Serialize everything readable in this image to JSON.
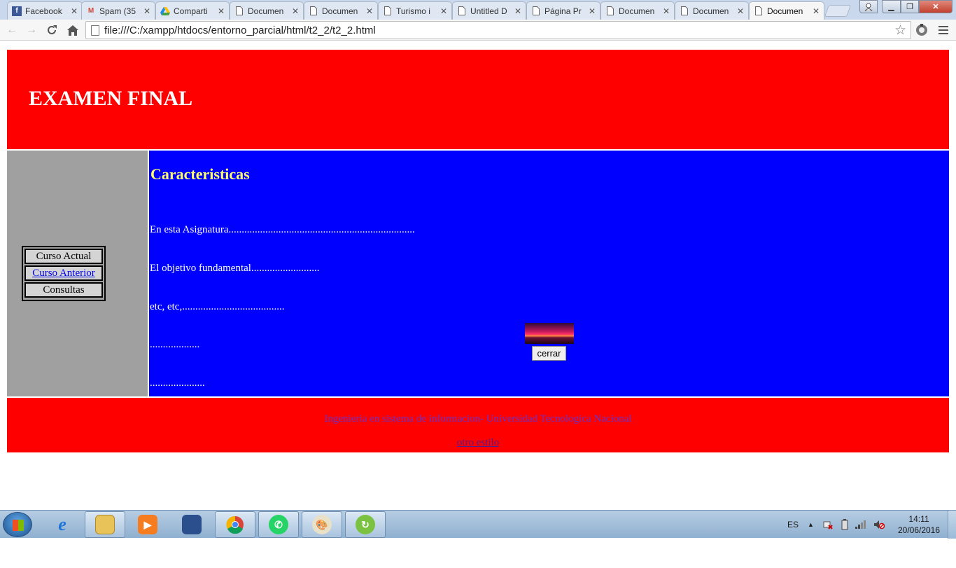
{
  "browser": {
    "tabs": [
      {
        "label": "Facebook",
        "icon": "facebook-icon",
        "active": false
      },
      {
        "label": "Spam (35",
        "icon": "gmail-icon",
        "active": false
      },
      {
        "label": "Comparti",
        "icon": "drive-icon",
        "active": false
      },
      {
        "label": "Documen",
        "icon": "document-icon",
        "active": false
      },
      {
        "label": "Documen",
        "icon": "document-icon",
        "active": false
      },
      {
        "label": "Turismo i",
        "icon": "document-icon",
        "active": false
      },
      {
        "label": "Untitled D",
        "icon": "document-icon",
        "active": false
      },
      {
        "label": "Página Pr",
        "icon": "document-icon",
        "active": false
      },
      {
        "label": "Documen",
        "icon": "document-icon",
        "active": false
      },
      {
        "label": "Documen",
        "icon": "document-icon",
        "active": false
      },
      {
        "label": "Documen",
        "icon": "document-icon",
        "active": true
      }
    ],
    "url": "file:///C:/xampp/htdocs/entorno_parcial/html/t2_2/t2_2.html"
  },
  "page": {
    "header_title": "EXAMEN FINAL",
    "menu": [
      {
        "label": "Curso Actual",
        "link": false
      },
      {
        "label": "Curso Anterior",
        "link": true
      },
      {
        "label": "Consultas",
        "link": false
      }
    ],
    "content_title": "Caracteristicas",
    "lines": [
      "En esta Asignatura.......................................................................",
      "El objetivo fundamental..........................",
      "etc, etc,.......................................",
      "...................",
      ".....................",
      "....",
      "...",
      "..",
      "."
    ],
    "close_button": "cerrar",
    "footer_text": "Ingenieria en sistema de informacion- Universidad Tecnologica Nacional",
    "footer_link": "otro estilo"
  },
  "taskbar": {
    "language": "ES",
    "time": "14:11",
    "date": "20/06/2016"
  },
  "colors": {
    "header_bg": "#ff0000",
    "sidebar_bg": "#a0a0a0",
    "content_bg": "#0000ff",
    "content_title": "#ffff66",
    "footer_text": "#6633cc"
  }
}
